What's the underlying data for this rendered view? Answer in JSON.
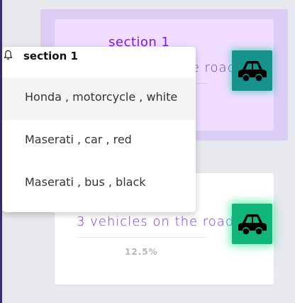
{
  "sections": [
    {
      "title": "section 1",
      "subtitle": "3 vehicles on the road",
      "icon": "car-icon",
      "icon_color": "#16928a"
    },
    {
      "subtitle": "3 vehicles on the road",
      "percent": "12.5%",
      "icon": "car-icon",
      "icon_color": "#11b479"
    }
  ],
  "dropdown": {
    "title": "section 1",
    "icon": "bell-icon",
    "items": [
      {
        "label": "Honda , motorcycle , white",
        "highlighted": true
      },
      {
        "label": "Maserati , car , red"
      },
      {
        "label": "Maserati , bus , black"
      }
    ]
  },
  "colors": {
    "accent": "#7a34dc",
    "highlight_panel": "#dccdf4",
    "highlight_card": "#f0ddff"
  }
}
